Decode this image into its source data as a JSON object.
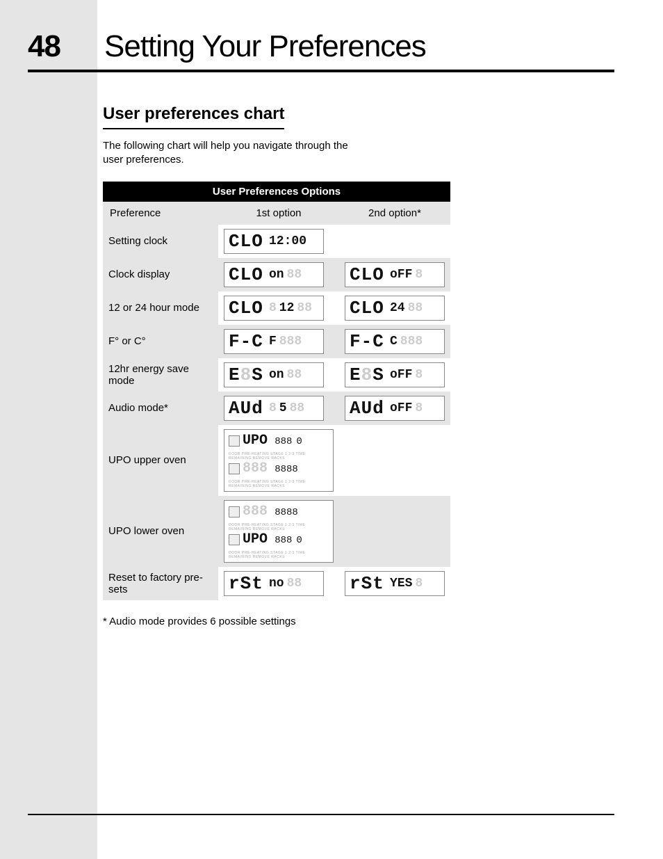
{
  "page": {
    "number": "48",
    "title": "Setting Your Preferences"
  },
  "section": {
    "heading": "User preferences chart",
    "intro": "The following chart will help you navigate through the user preferences.",
    "footnote": "* Audio mode provides 6 possible settings"
  },
  "table": {
    "title": "User Preferences Options",
    "columns": [
      "Preference",
      "1st option",
      "2nd option*"
    ],
    "rows": [
      {
        "label": "Setting clock",
        "opt1": {
          "code": "CLO",
          "value": "12:00"
        }
      },
      {
        "label": "Clock display",
        "opt1": {
          "code": "CLO",
          "value": "on",
          "ghost": "88"
        },
        "opt2": {
          "code": "CLO",
          "value": "oFF",
          "ghost": "8"
        }
      },
      {
        "label": "12 or 24 hour mode",
        "opt1": {
          "code": "CLO",
          "ghostpre": "8",
          "value": "12",
          "ghost": "88"
        },
        "opt2": {
          "code": "CLO",
          "value": "24",
          "ghost": "88"
        }
      },
      {
        "label": "F° or C°",
        "opt1": {
          "code": "F-C",
          "value": "F",
          "ghost": "888"
        },
        "opt2": {
          "code": "F-C",
          "value": "C",
          "ghost": "888"
        }
      },
      {
        "label": "12hr energy save mode",
        "opt1": {
          "code_a": "E",
          "code_ghost": "8",
          "code_b": "S",
          "value": "on",
          "ghost": "88"
        },
        "opt2": {
          "code_a": "E",
          "code_ghost": "8",
          "code_b": "S",
          "value": "oFF",
          "ghost": "8"
        }
      },
      {
        "label": "Audio mode*",
        "opt1": {
          "code": "AUd",
          "ghostpre": "8",
          "value": "5",
          "ghost": "88"
        },
        "opt2": {
          "code": "AUd",
          "value": "oFF",
          "ghost": "8"
        }
      },
      {
        "label": "UPO upper oven",
        "opt1": {
          "line1": {
            "code": "UPO",
            "ghost": "888",
            "value": "0"
          },
          "line2": {
            "code": "888",
            "ghost": "8888"
          },
          "annot": "DOOR  PRE-HEATING  STAGE 1 2 3  TIME REMAINING  REMOVE RACKS"
        }
      },
      {
        "label": "UPO lower oven",
        "opt1": {
          "line1": {
            "code": "888",
            "ghost": "8888"
          },
          "line2": {
            "code": "UPO",
            "ghost": "888",
            "value": "0"
          },
          "annot": "DOOR  PRE-HEATING  STAGE 1 2 3  TIME REMAINING  REMOVE RACKS"
        }
      },
      {
        "label": "Reset to factory pre-sets",
        "opt1": {
          "code": "rSt",
          "value": "no",
          "ghost": "88"
        },
        "opt2": {
          "code": "rSt",
          "value": "YES",
          "ghost": "8"
        }
      }
    ]
  }
}
